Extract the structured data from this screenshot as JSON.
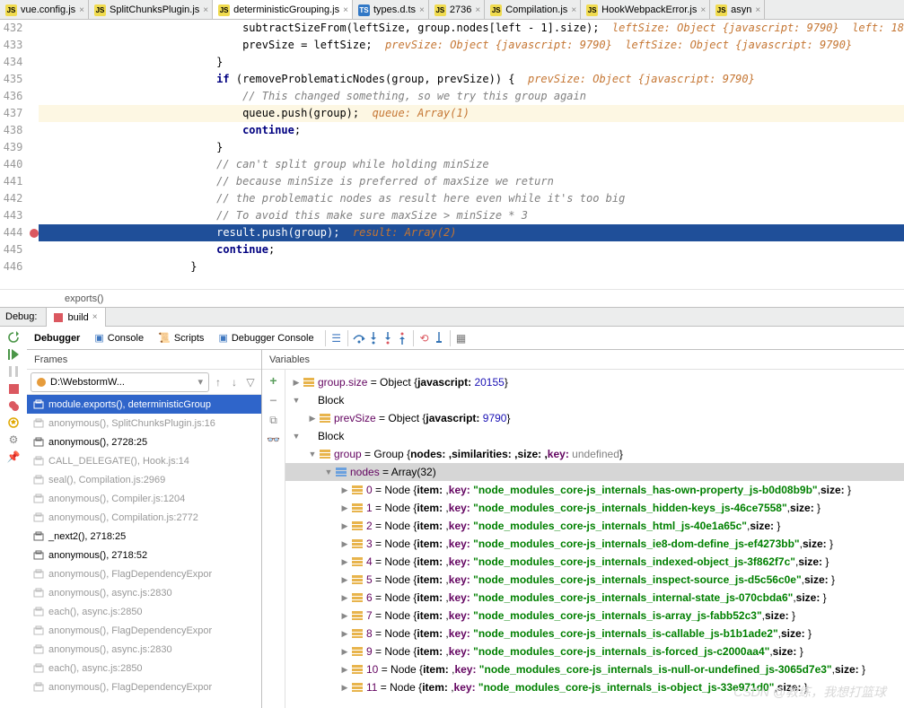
{
  "tabs": [
    {
      "label": "vue.config.js",
      "type": "js"
    },
    {
      "label": "SplitChunksPlugin.js",
      "type": "js"
    },
    {
      "label": "deterministicGrouping.js",
      "type": "js",
      "active": true
    },
    {
      "label": "types.d.ts",
      "type": "ts"
    },
    {
      "label": "2736",
      "type": "js"
    },
    {
      "label": "Compilation.js",
      "type": "js"
    },
    {
      "label": "HookWebpackError.js",
      "type": "js"
    },
    {
      "label": "asyn",
      "type": "js"
    }
  ],
  "code_lines": [
    {
      "n": "432",
      "pre": "            ",
      "text": "subtractSizeFrom(leftSize, group.nodes[left - 1].size);",
      "hint": "  leftSize: Object {javascript: 9790}  left: 18"
    },
    {
      "n": "433",
      "pre": "            ",
      "text": "prevSize = leftSize;",
      "hint": "  prevSize: Object {javascript: 9790}  leftSize: Object {javascript: 9790}"
    },
    {
      "n": "434",
      "pre": "        ",
      "text": "}"
    },
    {
      "n": "435",
      "pre": "        ",
      "kw": "if ",
      "text": "(removeProblematicNodes(group, prevSize)) {",
      "hint": "  prevSize: Object {javascript: 9790}"
    },
    {
      "n": "436",
      "pre": "            ",
      "comment": "// This changed something, so we try this group again"
    },
    {
      "n": "437",
      "pre": "            ",
      "text": "queue.push(group);",
      "hint": "  queue: Array(1)",
      "hl": "yellow"
    },
    {
      "n": "438",
      "pre": "            ",
      "kw": "continue",
      "text": ";"
    },
    {
      "n": "439",
      "pre": "        ",
      "text": "}"
    },
    {
      "n": "440",
      "pre": "        ",
      "comment": "// can't split group while holding minSize"
    },
    {
      "n": "441",
      "pre": "        ",
      "comment": "// because minSize is preferred of maxSize we return"
    },
    {
      "n": "442",
      "pre": "        ",
      "comment": "// the problematic nodes as result here even while it's too big"
    },
    {
      "n": "443",
      "pre": "        ",
      "comment": "// To avoid this make sure maxSize > minSize * 3"
    },
    {
      "n": "444",
      "pre": "        ",
      "text": "result.push(group);",
      "hint": "  result: Array(2)",
      "hl": "blue",
      "bp": true
    },
    {
      "n": "445",
      "pre": "        ",
      "kw": "continue",
      "text": ";"
    },
    {
      "n": "446",
      "pre": "    ",
      "text": "}"
    }
  ],
  "breadcrumb": "exports()",
  "debug": {
    "label": "Debug:",
    "tab": "build"
  },
  "toolbar": {
    "debugger": "Debugger",
    "console": "Console",
    "scripts": "Scripts",
    "dconsole": "Debugger Console"
  },
  "frames": {
    "header": "Frames",
    "thread": "D:\\WebstormW...",
    "items": [
      {
        "text": "module.exports(), deterministicGroup",
        "sel": true
      },
      {
        "text": "anonymous(), SplitChunksPlugin.js:16",
        "dim": true
      },
      {
        "text": "anonymous(), 2728:25"
      },
      {
        "text": "CALL_DELEGATE(), Hook.js:14",
        "dim": true
      },
      {
        "text": "seal(), Compilation.js:2969",
        "dim": true
      },
      {
        "text": "anonymous(), Compiler.js:1204",
        "dim": true
      },
      {
        "text": "anonymous(), Compilation.js:2772",
        "dim": true
      },
      {
        "text": "_next2(), 2718:25"
      },
      {
        "text": "anonymous(), 2718:52"
      },
      {
        "text": "anonymous(), FlagDependencyExpor",
        "dim": true
      },
      {
        "text": "anonymous(), async.js:2830",
        "dim": true
      },
      {
        "text": "each(), async.js:2850",
        "dim": true
      },
      {
        "text": "anonymous(), FlagDependencyExpor",
        "dim": true
      },
      {
        "text": "anonymous(), async.js:2830",
        "dim": true
      },
      {
        "text": "each(), async.js:2850",
        "dim": true
      },
      {
        "text": "anonymous(), FlagDependencyExpor",
        "dim": true
      }
    ]
  },
  "variables": {
    "header": "Variables",
    "group_size": {
      "name": "group.size",
      "type": "Object",
      "val": "javascript: 20155"
    },
    "block1": "Block",
    "prevSize": {
      "name": "prevSize",
      "type": "Object",
      "val": "javascript: 9790"
    },
    "block2": "Block",
    "group": {
      "name": "group",
      "type": "Group",
      "parts": "nodes: ,similarities: ,size: ,",
      "key": "key: ",
      "und": "undefined"
    },
    "nodes": {
      "name": "nodes",
      "val": "Array(32)"
    },
    "items": [
      {
        "i": "0",
        "k": "\"node_modules_core-js_internals_has-own-property_js-b0d08b9b\""
      },
      {
        "i": "1",
        "k": "\"node_modules_core-js_internals_hidden-keys_js-46ce7558\""
      },
      {
        "i": "2",
        "k": "\"node_modules_core-js_internals_html_js-40e1a65c\""
      },
      {
        "i": "3",
        "k": "\"node_modules_core-js_internals_ie8-dom-define_js-ef4273bb\""
      },
      {
        "i": "4",
        "k": "\"node_modules_core-js_internals_indexed-object_js-3f862f7c\""
      },
      {
        "i": "5",
        "k": "\"node_modules_core-js_internals_inspect-source_js-d5c56c0e\""
      },
      {
        "i": "6",
        "k": "\"node_modules_core-js_internals_internal-state_js-070cbda6\""
      },
      {
        "i": "7",
        "k": "\"node_modules_core-js_internals_is-array_js-fabb52c3\""
      },
      {
        "i": "8",
        "k": "\"node_modules_core-js_internals_is-callable_js-b1b1ade2\""
      },
      {
        "i": "9",
        "k": "\"node_modules_core-js_internals_is-forced_js-c2000aa4\""
      },
      {
        "i": "10",
        "k": "\"node_modules_core-js_internals_is-null-or-undefined_js-3065d7e3\""
      },
      {
        "i": "11",
        "k": "\"node_modules_core-js_internals_is-object_js-33e971d0\""
      }
    ]
  },
  "watermark": "CSDN @教练，我想打篮球"
}
